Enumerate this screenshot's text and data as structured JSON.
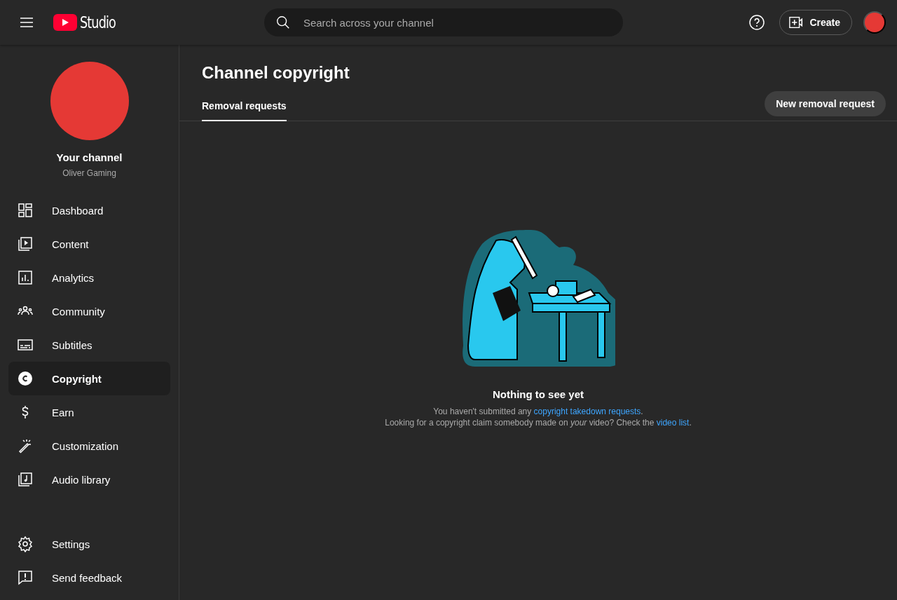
{
  "header": {
    "logo_text": "Studio",
    "search": {
      "placeholder": "Search across your channel"
    },
    "create_label": "Create"
  },
  "channel": {
    "title": "Your channel",
    "name": "Oliver Gaming"
  },
  "sidebar": {
    "items": [
      {
        "label": "Dashboard",
        "selected": false
      },
      {
        "label": "Content",
        "selected": false
      },
      {
        "label": "Analytics",
        "selected": false
      },
      {
        "label": "Community",
        "selected": false
      },
      {
        "label": "Subtitles",
        "selected": false
      },
      {
        "label": "Copyright",
        "selected": true
      },
      {
        "label": "Earn",
        "selected": false
      },
      {
        "label": "Customization",
        "selected": false
      },
      {
        "label": "Audio library",
        "selected": false
      }
    ],
    "footer_items": [
      {
        "label": "Settings",
        "selected": false
      },
      {
        "label": "Send feedback",
        "selected": false
      }
    ]
  },
  "page": {
    "title": "Channel copyright",
    "tabs": [
      {
        "label": "Removal requests",
        "selected": true
      }
    ],
    "action_button": "New removal request",
    "empty_state": {
      "heading": "Nothing to see yet",
      "lines": [
        {
          "before": "You haven't submitted any ",
          "link": "copyright takedown requests",
          "after": "."
        },
        {
          "before": "Looking for a copyright claim somebody made on *your* video? Check the ",
          "link": "video list",
          "after": "."
        }
      ]
    }
  }
}
